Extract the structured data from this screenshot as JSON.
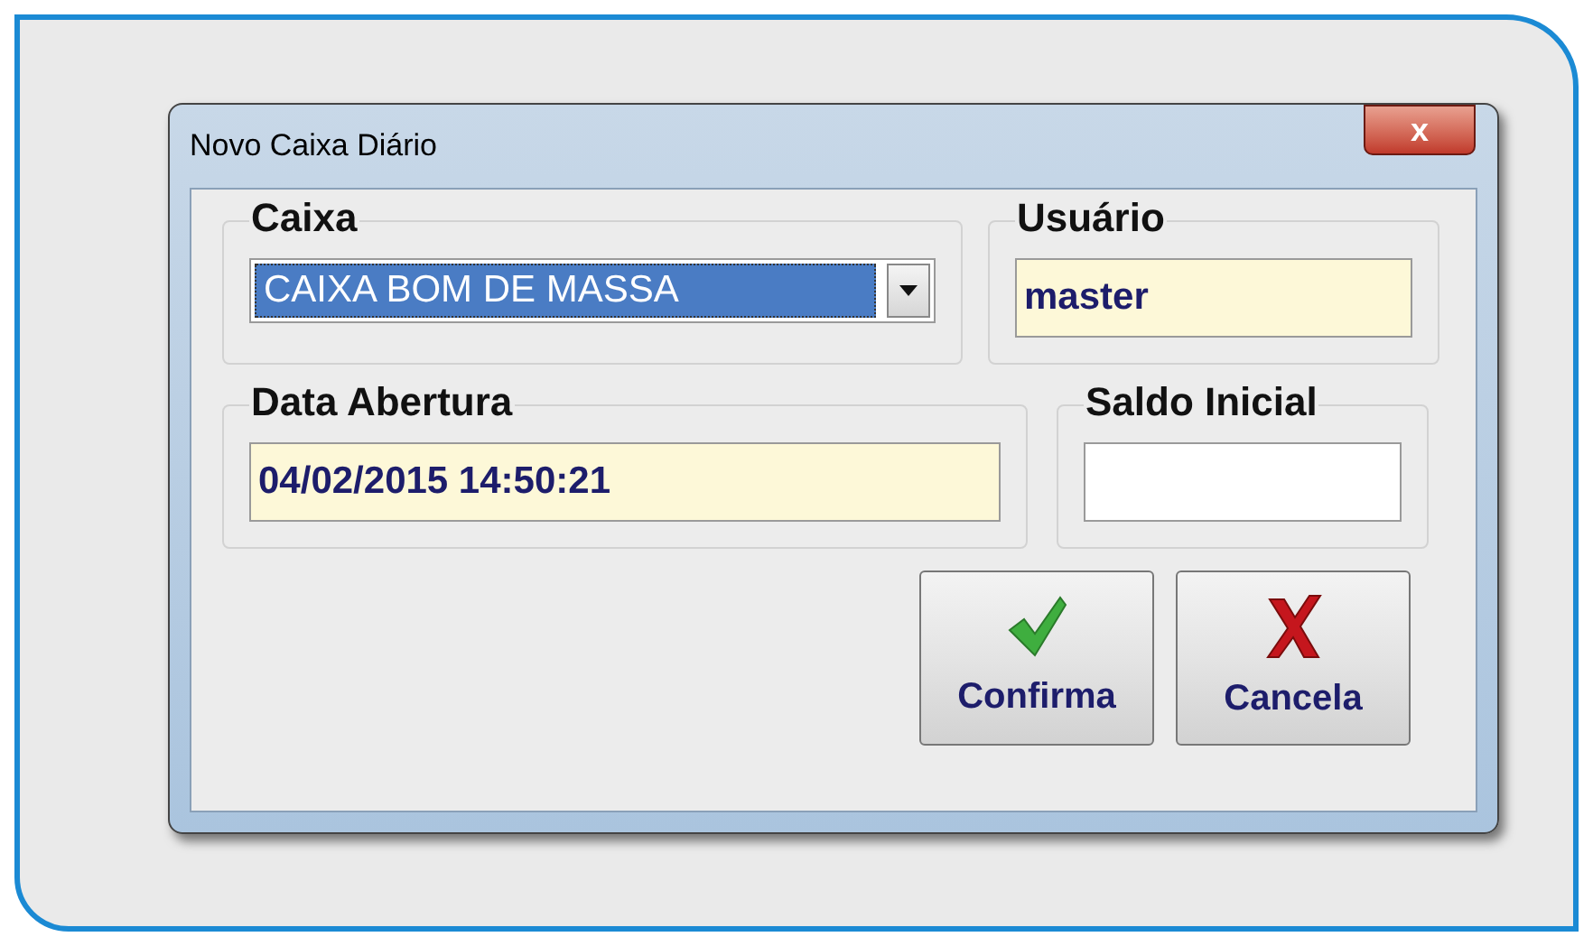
{
  "window": {
    "title": "Novo Caixa Diário",
    "close_label": "x"
  },
  "groups": [
    {
      "kind": "combo",
      "title": "Caixa",
      "value": "CAIXA BOM DE MASSA",
      "selected": true
    },
    {
      "kind": "readonly",
      "title": "Usuário",
      "value": "master"
    },
    {
      "kind": "readonly",
      "title": "Data Abertura",
      "value": "04/02/2015 14:50:21"
    },
    {
      "kind": "input",
      "title": "Saldo Inicial"
    }
  ],
  "buttons": [
    {
      "kind": "confirm",
      "label": "Confirma"
    },
    {
      "kind": "cancel",
      "label": "Cancela"
    }
  ]
}
